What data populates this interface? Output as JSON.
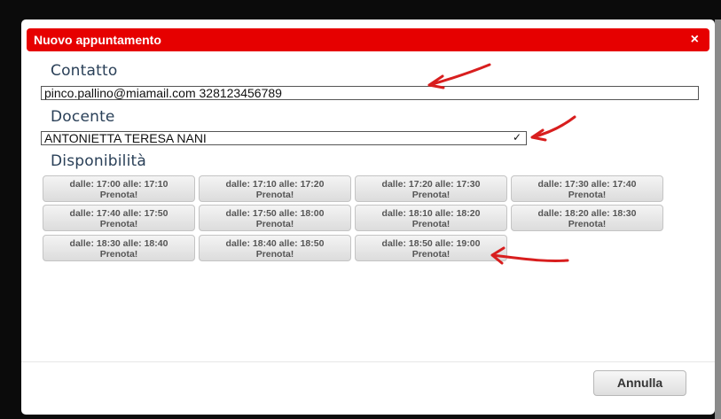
{
  "dialog": {
    "title": "Nuovo appuntamento",
    "close_glyph": "×"
  },
  "contatto": {
    "label": "Contatto",
    "value": "pinco.pallino@miamail.com  328123456789"
  },
  "docente": {
    "label": "Docente",
    "value": "ANTONIETTA TERESA NANI",
    "chevron": "✓"
  },
  "disponibilita": {
    "label": "Disponibilità",
    "slots": [
      {
        "time": "dalle: 17:00 alle: 17:10",
        "action": "Prenota!"
      },
      {
        "time": "dalle: 17:10 alle: 17:20",
        "action": "Prenota!"
      },
      {
        "time": "dalle: 17:20 alle: 17:30",
        "action": "Prenota!"
      },
      {
        "time": "dalle: 17:30 alle: 17:40",
        "action": "Prenota!"
      },
      {
        "time": "dalle: 17:40 alle: 17:50",
        "action": "Prenota!"
      },
      {
        "time": "dalle: 17:50 alle: 18:00",
        "action": "Prenota!"
      },
      {
        "time": "dalle: 18:10 alle: 18:20",
        "action": "Prenota!"
      },
      {
        "time": "dalle: 18:20 alle: 18:30",
        "action": "Prenota!"
      },
      {
        "time": "dalle: 18:30 alle: 18:40",
        "action": "Prenota!"
      },
      {
        "time": "dalle: 18:40 alle: 18:50",
        "action": "Prenota!"
      },
      {
        "time": "dalle: 18:50 alle: 19:00",
        "action": "Prenota!"
      }
    ]
  },
  "footer": {
    "cancel_label": "Annulla"
  },
  "colors": {
    "titlebar": "#e60000",
    "annotation_arrows": "#d81e1e",
    "section_label": "#2a4058"
  }
}
